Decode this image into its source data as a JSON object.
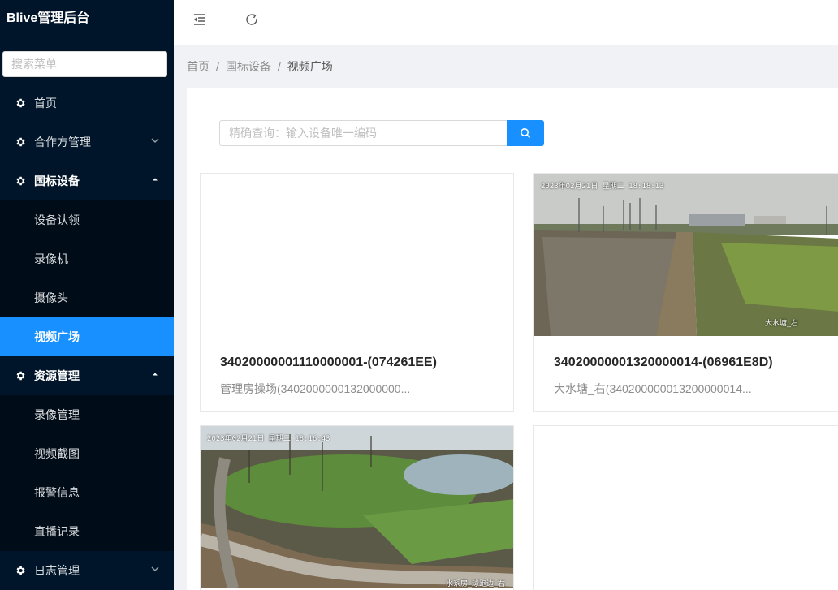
{
  "app": {
    "title": "Blive管理后台"
  },
  "sidebar": {
    "search_placeholder": "搜索菜单",
    "items": [
      {
        "label": "首页",
        "icon": "gear-icon",
        "has_arrow": false
      },
      {
        "label": "合作方管理",
        "icon": "gear-icon",
        "arrow": "chevron-down-icon"
      },
      {
        "label": "国标设备",
        "icon": "gear-icon",
        "arrow": "chevron-up-icon",
        "open": true,
        "children": [
          {
            "label": "设备认领"
          },
          {
            "label": "录像机"
          },
          {
            "label": "摄像头"
          },
          {
            "label": "视频广场",
            "active": true
          }
        ]
      },
      {
        "label": "资源管理",
        "icon": "gear-icon",
        "arrow": "chevron-up-icon",
        "open": true,
        "children": [
          {
            "label": "录像管理"
          },
          {
            "label": "视频截图"
          },
          {
            "label": "报警信息"
          },
          {
            "label": "直播记录"
          }
        ]
      },
      {
        "label": "日志管理",
        "icon": "gear-icon",
        "arrow": "chevron-down-icon"
      }
    ]
  },
  "header": {
    "collapse_icon": "menu-fold-icon",
    "refresh_icon": "refresh-icon"
  },
  "breadcrumb": [
    "首页",
    "国标设备",
    "视频广场"
  ],
  "search": {
    "placeholder": "精确查询：输入设备唯一编码",
    "button_icon": "search-icon"
  },
  "cards": [
    {
      "title": "34020000001110000001-(074261EE)",
      "desc": "管理房操场(3402000000132000000...",
      "has_image": false
    },
    {
      "title": "34020000001320000014-(06961E8D)",
      "desc": "大水塘_右(340200000013200000014...",
      "has_image": true,
      "timestamp": "2023年02月21日 星期二 18:18:13",
      "cam_label": "大水塘_右"
    },
    {
      "title": "",
      "desc": "",
      "has_image": true,
      "timestamp": "2023年02月21日 星期二 18:16:43",
      "cam_label": "水系房_球跑边_右"
    },
    {
      "title": "",
      "desc": "",
      "has_image": false
    }
  ],
  "colors": {
    "sidebar_bg": "#001529",
    "submenu_bg": "#000c17",
    "accent": "#1890ff"
  }
}
